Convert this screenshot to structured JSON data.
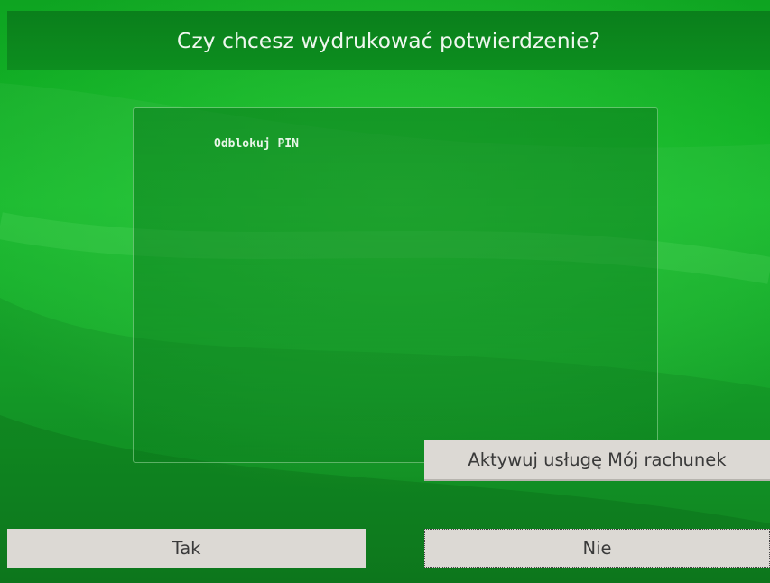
{
  "header": {
    "title": "Czy chcesz wydrukować potwierdzenie?"
  },
  "receipt": {
    "text": "Odblokuj PIN"
  },
  "buttons": {
    "activate_label": "Aktywuj usługę Mój rachunek",
    "yes_label": "Tak",
    "no_label": "Nie"
  },
  "colors": {
    "background": "#12b828",
    "title_bar": "#0a7f1b",
    "button_face": "#dcd9d4",
    "button_text": "#3a3a3a"
  }
}
